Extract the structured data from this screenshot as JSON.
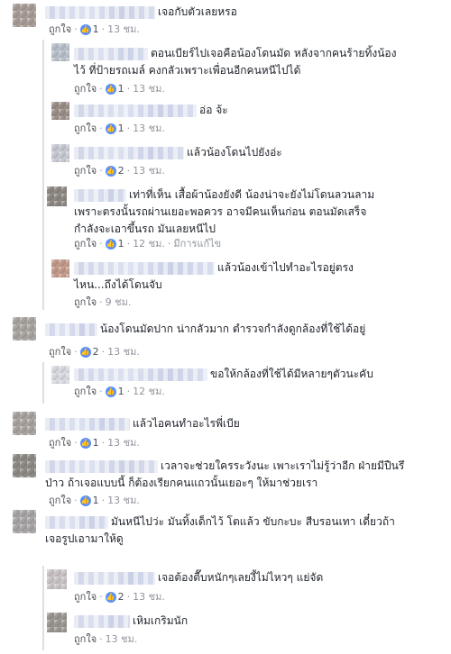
{
  "ui": {
    "like_label": "ถูกใจ",
    "separator": "·",
    "like_icon": "thumbs-up-icon",
    "accent_color": "#5890ff"
  },
  "comments": [
    {
      "lines": [
        "เจอกับตัวเลยหรอ"
      ],
      "likes": "1",
      "time": "13 ชม.",
      "edited": ""
    },
    {
      "lines": [
        "ตอนเบียร์ไปเจอคือน้องโดนมัด หลังจากคนร้ายทิ้งน้อง",
        "ไว้ ที่ป้ายรถเมล์ คงกลัวเพราะเพื่อนอีกคนหนีไปได้"
      ],
      "likes": "1",
      "time": "13 ชม.",
      "edited": ""
    },
    {
      "lines": [
        "อ่อ จ้ะ"
      ],
      "likes": "1",
      "time": "13 ชม.",
      "edited": ""
    },
    {
      "lines": [
        "แล้วน้องโดนไปยังอ่ะ"
      ],
      "likes": "2",
      "time": "13 ชม.",
      "edited": ""
    },
    {
      "lines": [
        "เท่าที่เห็น เสื้อผ้าน้องยังดี น้องน่าจะยังไม่โดนลวนลาม",
        "เพราะตรงนั้นรถผ่านเยอะพอควร อาจมีคนเห็นก่อน ตอนมัดเสร็จ",
        "กำลังจะเอาขึ้นรถ มันเลยหนีไป"
      ],
      "likes": "1",
      "time": "12 ชม.",
      "edited": "มีการแก้ไข"
    },
    {
      "lines": [
        "แล้วน้องเข้าไปทำอะไรอยู่ตรง",
        "ไหน...ถึงได้โดนจับ"
      ],
      "likes": "",
      "time": "9 ชม.",
      "edited": ""
    },
    {
      "lines": [
        "น้องโดนมัดปาก น่ากลัวมาก ตำรวจกำลังดูกล้องที่ใช้ได้อยู่"
      ],
      "likes": "2",
      "time": "13 ชม.",
      "edited": ""
    },
    {
      "lines": [
        "ขอให้กล้องที่ใช้ได้มีหลายๆตัวนะคับ"
      ],
      "likes": "1",
      "time": "12 ชม.",
      "edited": ""
    },
    {
      "lines": [
        "แล้วไอคนทำอะไรพี่เบีย"
      ],
      "likes": "1",
      "time": "13 ชม.",
      "edited": ""
    },
    {
      "lines": [
        "เวลาจะช่วยใครระวังนะ เพาะเราไม่รู้ว่าอีก ฝ่ายมีปืนรึ",
        "ป่าว ถ้าเจอแบบนี้ ก็ต้องเรียกคนแถวนั้นเยอะๆ ให้มาช่วยเรา"
      ],
      "likes": "1",
      "time": "13 ชม.",
      "edited": ""
    },
    {
      "lines": [
        "มันหนีไปว่ะ มันทิ้งเด็กไว้ โตแล้ว ขับกะบะ สีบรอนเทา เดี๋ยวถ้า",
        "เจอรูปเอามาให้ดู"
      ],
      "likes": "",
      "time": "13 ชม.",
      "edited": ""
    },
    {
      "lines": [
        "เจอต้องตื๊บหนักๆเลยงี้ไม่ไหวๆ แย่จัด"
      ],
      "likes": "2",
      "time": "13 ชม.",
      "edited": ""
    },
    {
      "lines": [
        "เหิมเกริมนัก"
      ],
      "likes": "",
      "time": "13 ชม.",
      "edited": ""
    }
  ]
}
